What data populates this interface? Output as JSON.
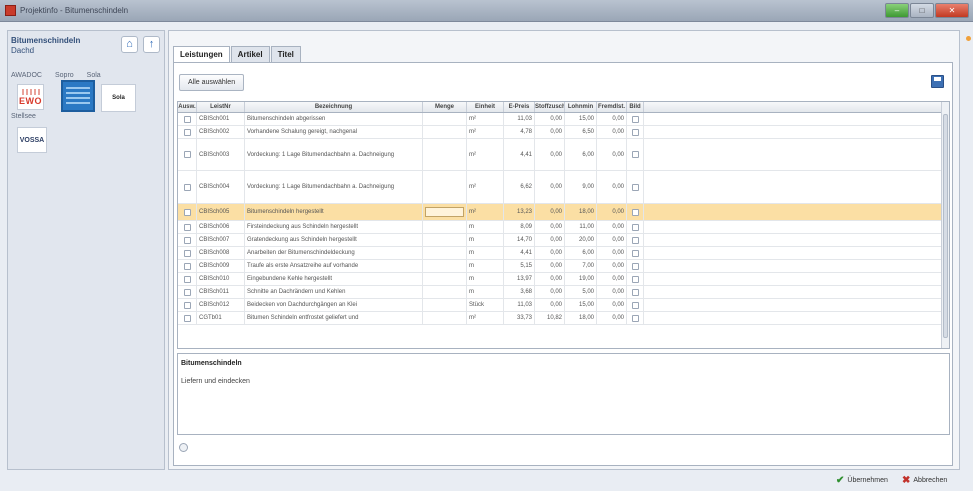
{
  "window": {
    "title": "Projektinfo  -  Bitumenschindeln",
    "min_label": "–",
    "max_label": "□",
    "close_label": "✕"
  },
  "left_panel": {
    "title": "Bitumenschindeln",
    "subtitle": "Dachd",
    "brands": [
      "AWADOC",
      "Sopro",
      "Sola"
    ],
    "brand2": "Stellsee",
    "logo_ewo": "EWO",
    "logo_sola": "Sola",
    "logo_vossa": "VOSSA",
    "home_icon": "home-icon",
    "up_icon": "arrow-up-icon"
  },
  "tabs": [
    {
      "label": "Leistungen"
    },
    {
      "label": "Artikel"
    },
    {
      "label": "Titel"
    }
  ],
  "toolbar": {
    "select_all_label": "Alle auswählen"
  },
  "table": {
    "headers": [
      "Ausw.",
      "LeistNr",
      "Bezeichnung",
      "Menge",
      "Einheit",
      "E-Preis",
      "Stoffzuschl.",
      "Lohnmin",
      "Fremdlst.",
      "Bild"
    ],
    "rows": [
      {
        "nr": "CBISch001",
        "bez": "Bitumenschindeln abgerissen",
        "einheit": "m²",
        "ep": "11,03",
        "stoff": "0,00",
        "lohn": "15,00",
        "fremd": "0,00"
      },
      {
        "nr": "CBISch002",
        "bez": "Vorhandene Schalung gereigt, nachgenal",
        "einheit": "m²",
        "ep": "4,78",
        "stoff": "0,00",
        "lohn": "6,50",
        "fremd": "0,00"
      },
      {
        "nr": "CBISch003",
        "bez": "Vordeckung: 1 Lage Bitumendachbahn a. Dachneigung",
        "einheit": "m²",
        "ep": "4,41",
        "stoff": "0,00",
        "lohn": "6,00",
        "fremd": "0,00"
      },
      {
        "nr": "CBISch004",
        "bez": "Vordeckung: 1 Lage Bitumendachbahn a. Dachneigung",
        "einheit": "m²",
        "ep": "6,62",
        "stoff": "0,00",
        "lohn": "9,00",
        "fremd": "0,00"
      },
      {
        "nr": "CBISch005",
        "bez": "Bitumenschindeln hergestellt",
        "einheit": "m²",
        "ep": "13,23",
        "stoff": "0,00",
        "lohn": "18,00",
        "fremd": "0,00"
      },
      {
        "nr": "CBISch006",
        "bez": "Firsteindeckung aus Schindeln hergestellt",
        "einheit": "m",
        "ep": "8,09",
        "stoff": "0,00",
        "lohn": "11,00",
        "fremd": "0,00"
      },
      {
        "nr": "CBISch007",
        "bez": "Gratendeckung aus Schindeln hergestellt",
        "einheit": "m",
        "ep": "14,70",
        "stoff": "0,00",
        "lohn": "20,00",
        "fremd": "0,00"
      },
      {
        "nr": "CBISch008",
        "bez": "Anarbeiten der Bitumenschindeldeckung",
        "einheit": "m",
        "ep": "4,41",
        "stoff": "0,00",
        "lohn": "6,00",
        "fremd": "0,00"
      },
      {
        "nr": "CBISch009",
        "bez": "Traufe als erste Ansatzreihe auf vorhande",
        "einheit": "m",
        "ep": "5,15",
        "stoff": "0,00",
        "lohn": "7,00",
        "fremd": "0,00"
      },
      {
        "nr": "CBISch010",
        "bez": "Eingebundene Kehle hergestellt",
        "einheit": "m",
        "ep": "13,97",
        "stoff": "0,00",
        "lohn": "19,00",
        "fremd": "0,00"
      },
      {
        "nr": "CBISch011",
        "bez": "Schnitte an Dachrändern und Kehlen",
        "einheit": "m",
        "ep": "3,68",
        "stoff": "0,00",
        "lohn": "5,00",
        "fremd": "0,00"
      },
      {
        "nr": "CBISch012",
        "bez": "Beidecken von Dachdurchgängen an Klei",
        "einheit": "Stück",
        "ep": "11,03",
        "stoff": "0,00",
        "lohn": "15,00",
        "fremd": "0,00"
      },
      {
        "nr": "CGTb01",
        "bez": "Bitumen Schindeln entfrostet geliefert und",
        "einheit": "m²",
        "ep": "33,73",
        "stoff": "10,82",
        "lohn": "18,00",
        "fremd": "0,00"
      }
    ]
  },
  "description": {
    "title": "Bitumenschindeln",
    "text": "Liefern und eindecken"
  },
  "footer": {
    "ok_label": "Übernehmen",
    "cancel_label": "Abbrechen"
  },
  "colors": {
    "selected_row": "#fbdfa4",
    "accent": "#2f6ab7"
  }
}
